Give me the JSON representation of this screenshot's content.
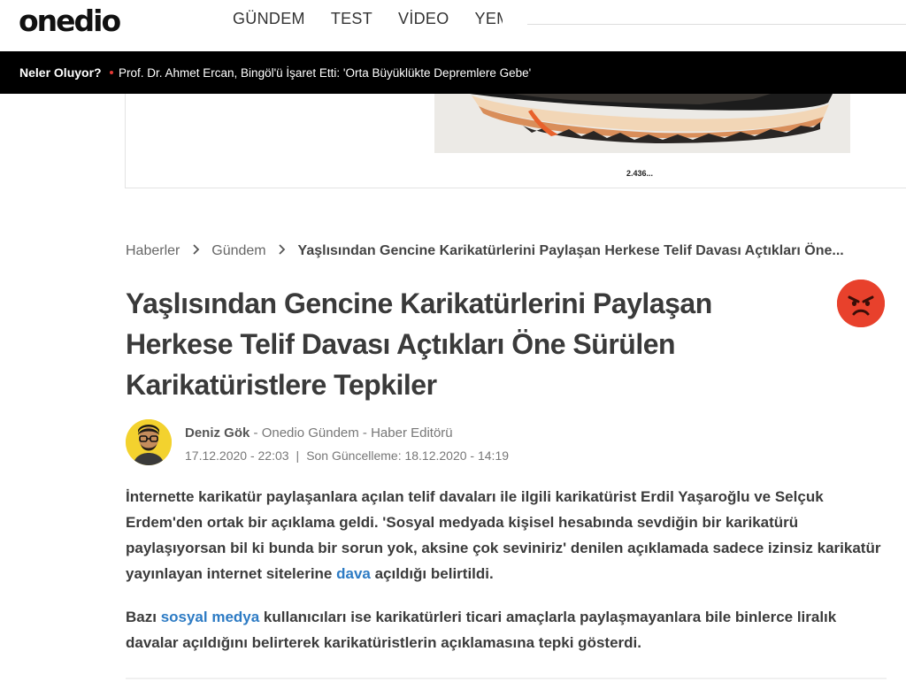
{
  "header": {
    "logo": "onedio",
    "nav": [
      "GÜNDEM",
      "TEST",
      "VİDEO",
      "YEMEK"
    ]
  },
  "ticker": {
    "label": "Neler Oluyor?",
    "headline": "Prof. Dr. Ahmet Ercan, Bingöl'ü İşaret Etti: 'Orta Büyüklükte Depremlere Gebe'"
  },
  "ad": {
    "count": "2.436..."
  },
  "breadcrumb": {
    "items": [
      "Haberler",
      "Gündem"
    ],
    "current": "Yaşlısından Gencine Karikatürlerini Paylaşan Herkese Telif Davası Açtıkları Öne..."
  },
  "article": {
    "title": "Yaşlısından Gencine Karikatürlerini Paylaşan Herkese Telif Davası Açtıkları Öne Sürülen Karikatüristlere Tepkiler",
    "author_name": "Deniz Gök",
    "author_meta": " - Onedio Gündem - Haber Editörü",
    "published": "17.12.2020 - 22:03",
    "updated": "Son Güncelleme: 18.12.2020 - 14:19",
    "p1_before": "İnternette karikatür paylaşanlara açılan telif davaları ile ilgili karikatürist Erdil Yaşaroğlu ve Selçuk Erdem'den ortak bir açıklama geldi. 'Sosyal medyada kişisel hesabında sevdiğin bir karikatürü paylaşıyorsan bil ki bunda bir sorun yok, aksine çok seviniriz' denilen açıklamada sadece izinsiz karikatür yayınlayan internet sitelerine ",
    "p1_link": "dava",
    "p1_after": " açıldığı belirtildi.",
    "p2_before": "Bazı ",
    "p2_link": "sosyal medya",
    "p2_after": " kullanıcıları ise karikatürleri ticari amaçlarla paylaşmayanlara bile binlerce liralık davalar açıldığını belirterek karikatüristlerin açıklamasına tepki gösterdi."
  },
  "colors": {
    "ticker_bg": "#000000",
    "link": "#2d7bc4",
    "reaction": "#e8412c"
  },
  "icons": {
    "breadcrumb_separator": "chevron-right-icon",
    "reaction": "angry-face-icon"
  }
}
